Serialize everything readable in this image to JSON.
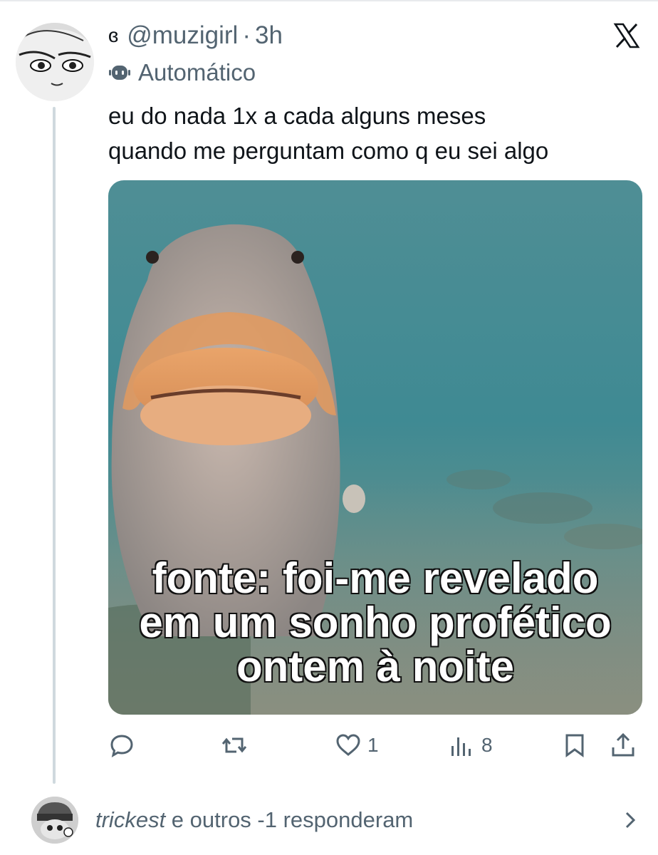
{
  "post": {
    "name_prefix": "ɞ",
    "handle": "@muzigirl",
    "separator": "·",
    "time": "3h",
    "automated_label": "Automático",
    "text_lines": [
      "eu do nada 1x a cada alguns meses",
      "quando me perguntam como q eu sei algo"
    ]
  },
  "media": {
    "caption_lines": [
      "fonte: foi-me revelado",
      "em um sonho profético",
      "ontem à noite"
    ]
  },
  "actions": {
    "reply_icon": "reply-icon",
    "repost_icon": "repost-icon",
    "like_icon": "heart-icon",
    "like_count": "1",
    "views_icon": "views-icon",
    "views_count": "8",
    "bookmark_icon": "bookmark-icon",
    "share_icon": "share-icon"
  },
  "replies": {
    "user": "trickest",
    "text": " e outros -1 responderam"
  },
  "colors": {
    "text_primary": "#0f1419",
    "text_secondary": "#536471",
    "thread_line": "#cfd9de"
  }
}
